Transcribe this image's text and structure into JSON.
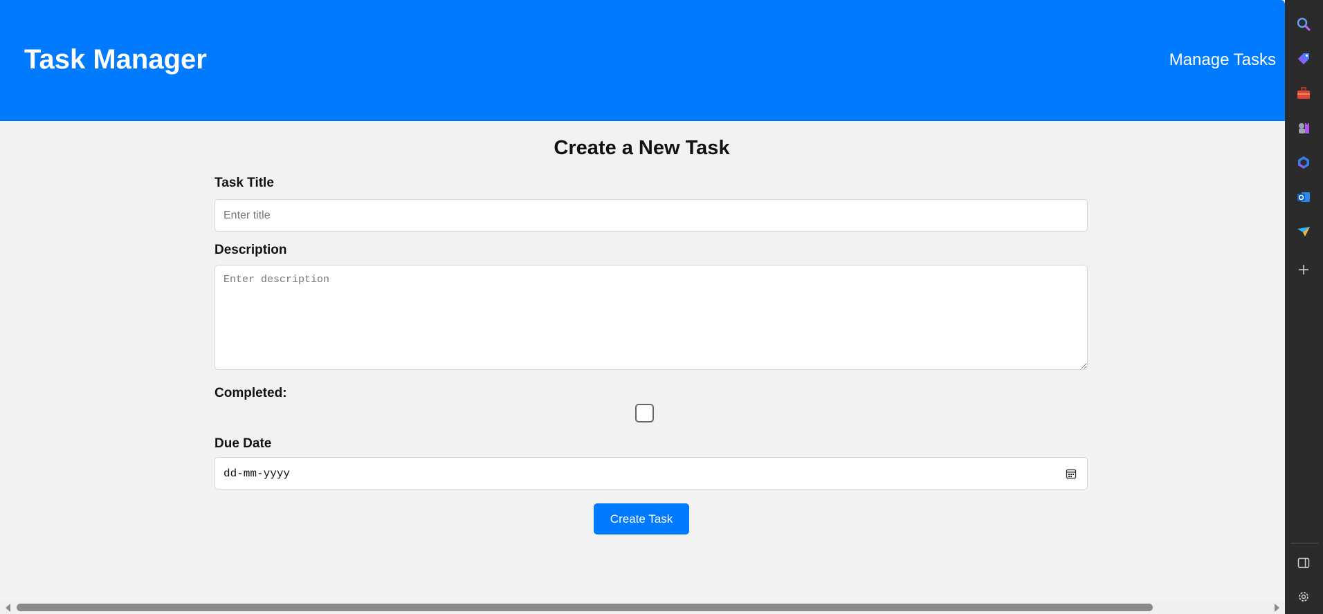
{
  "header": {
    "title": "Task Manager",
    "nav_link": "Manage Tasks",
    "color": "#007bff"
  },
  "form": {
    "heading": "Create a New Task",
    "title_label": "Task Title",
    "title_placeholder": "Enter title",
    "title_value": "",
    "description_label": "Description",
    "description_placeholder": "Enter description",
    "description_value": "",
    "completed_label": "Completed:",
    "completed_checked": false,
    "due_date_label": "Due Date",
    "due_date_value": "dd-mm-yyyy",
    "submit_label": "Create Task"
  },
  "sidebar": {
    "items": [
      {
        "icon": "search-icon"
      },
      {
        "icon": "shopping-tag-icon"
      },
      {
        "icon": "toolbox-icon"
      },
      {
        "icon": "games-icon"
      },
      {
        "icon": "copilot-icon"
      },
      {
        "icon": "outlook-icon"
      },
      {
        "icon": "send-icon"
      },
      {
        "icon": "add-icon"
      }
    ],
    "bottom_items": [
      {
        "icon": "sidebar-toggle-icon"
      },
      {
        "icon": "settings-gear-icon"
      }
    ]
  }
}
